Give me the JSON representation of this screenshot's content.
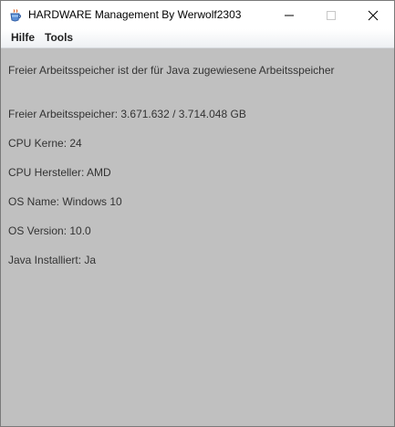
{
  "window": {
    "title": "HARDWARE Management By Werwolf2303"
  },
  "menubar": {
    "items": [
      {
        "label": "Hilfe"
      },
      {
        "label": "Tools"
      }
    ]
  },
  "content": {
    "description": "Freier Arbeitsspeicher ist der für Java zugewiesene Arbeitsspeicher",
    "free_memory": "Freier Arbeitsspeicher: 3.671.632 / 3.714.048 GB",
    "cpu_cores": "CPU Kerne: 24",
    "cpu_vendor": "CPU Hersteller: AMD",
    "os_name": "OS Name: Windows 10",
    "os_version": "OS Version: 10.0",
    "java_installed": "Java Installiert: Ja"
  },
  "icons": {
    "app": "java-cup-icon",
    "minimize": "minimize-icon",
    "maximize": "maximize-icon",
    "close": "close-icon"
  }
}
